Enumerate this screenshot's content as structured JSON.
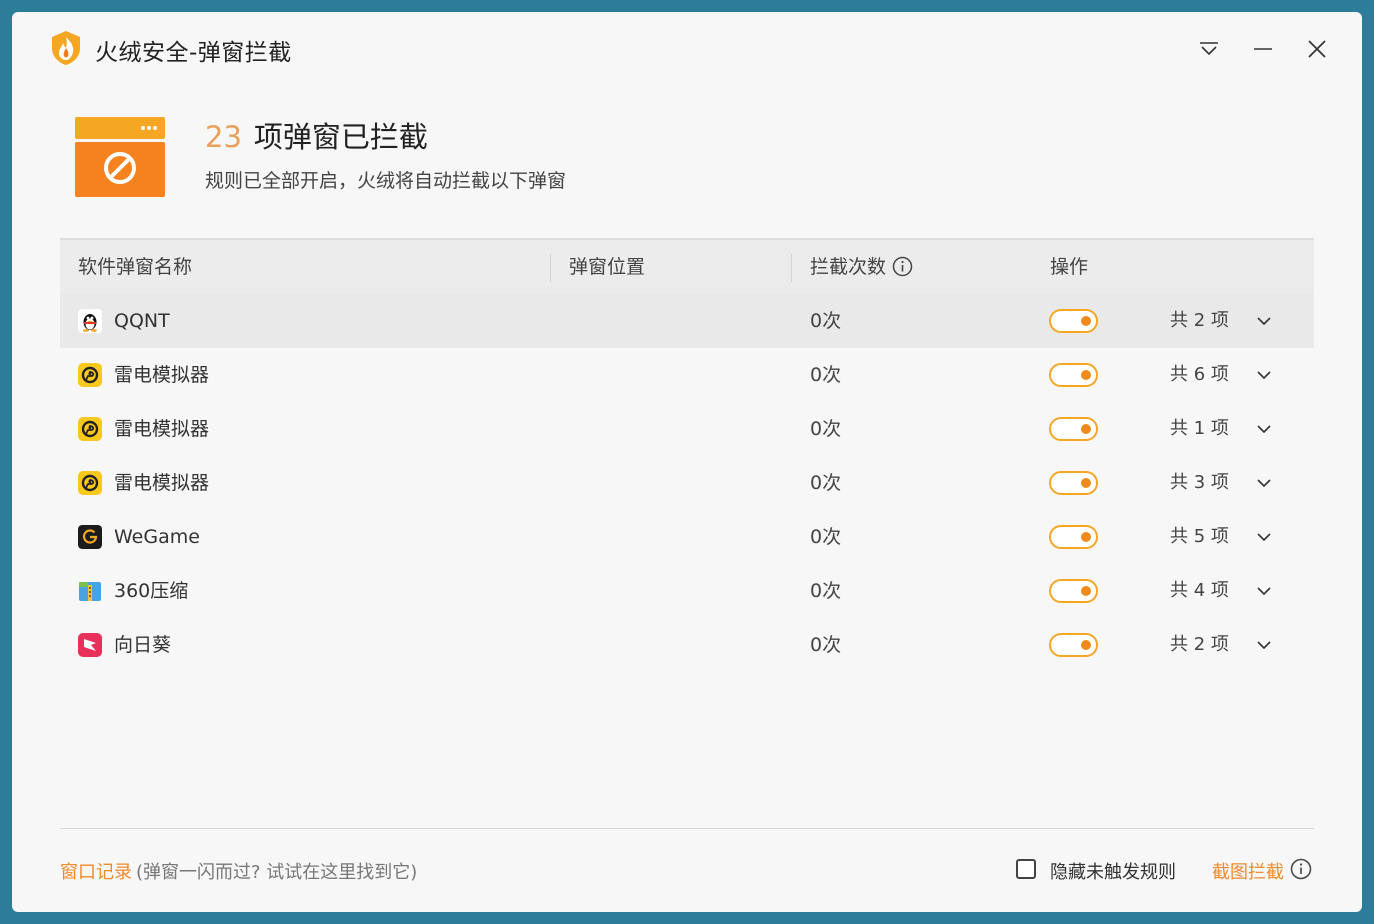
{
  "window": {
    "title": "火绒安全-弹窗拦截",
    "accent_color": "#f5a623"
  },
  "hero": {
    "count": "23",
    "title": "项弹窗已拦截",
    "subtitle": "规则已全部开启，火绒将自动拦截以下弹窗"
  },
  "table": {
    "headers": {
      "name": "软件弹窗名称",
      "position": "弹窗位置",
      "count": "拦截次数",
      "action": "操作"
    },
    "rows": [
      {
        "icon": "qq-icon",
        "name": "QQNT",
        "count": "0次",
        "enabled": true,
        "total": "共 2 项"
      },
      {
        "icon": "leidian-icon",
        "name": "雷电模拟器",
        "count": "0次",
        "enabled": true,
        "total": "共 6 项"
      },
      {
        "icon": "leidian-icon",
        "name": "雷电模拟器",
        "count": "0次",
        "enabled": true,
        "total": "共 1 项"
      },
      {
        "icon": "leidian-icon",
        "name": "雷电模拟器",
        "count": "0次",
        "enabled": true,
        "total": "共 3 项"
      },
      {
        "icon": "wegame-icon",
        "name": "WeGame",
        "count": "0次",
        "enabled": true,
        "total": "共 5 项"
      },
      {
        "icon": "360zip-icon",
        "name": "360压缩",
        "count": "0次",
        "enabled": true,
        "total": "共 4 项"
      },
      {
        "icon": "sunflower-icon",
        "name": "向日葵",
        "count": "0次",
        "enabled": true,
        "total": "共 2 项"
      }
    ]
  },
  "footer": {
    "history_link": "窗口记录",
    "history_hint": "(弹窗一闪而过? 试试在这里找到它)",
    "hide_untriggered_label": "隐藏未触发规则",
    "hide_untriggered_checked": false,
    "screenshot_block_link": "截图拦截"
  }
}
